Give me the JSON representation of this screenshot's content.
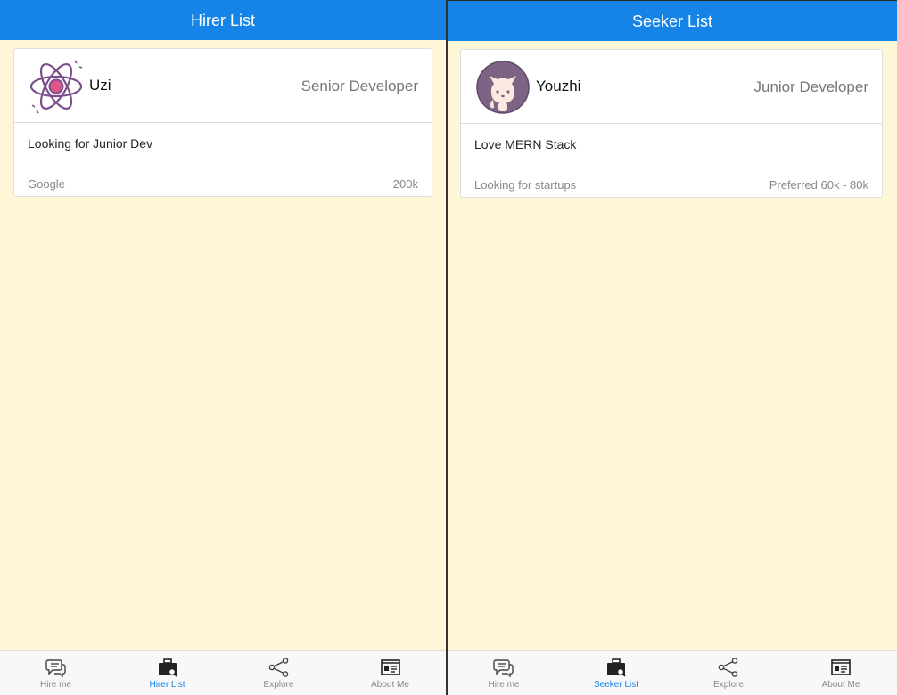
{
  "left": {
    "header": {
      "title": "Hirer List"
    },
    "card": {
      "avatar_icon": "react-atom-icon",
      "name": "Uzi",
      "role": "Senior Developer",
      "description": "Looking for Junior Dev",
      "company": "Google",
      "salary": "200k"
    },
    "tabs": [
      {
        "label": "Hire me",
        "icon": "chat-icon",
        "active": false
      },
      {
        "label": "Hirer List",
        "icon": "briefcase-icon",
        "active": true
      },
      {
        "label": "Explore",
        "icon": "share-icon",
        "active": false
      },
      {
        "label": "About Me",
        "icon": "id-card-icon",
        "active": false
      }
    ]
  },
  "right": {
    "header": {
      "title": "Seeker List"
    },
    "card": {
      "avatar_icon": "octocat-icon",
      "name": "Youzhi",
      "role": "Junior Developer",
      "description": "Love MERN Stack",
      "note": "Looking for startups",
      "salary": "Preferred 60k - 80k"
    },
    "tabs": [
      {
        "label": "Hire me",
        "icon": "chat-icon",
        "active": false
      },
      {
        "label": "Seeker List",
        "icon": "briefcase-icon",
        "active": true
      },
      {
        "label": "Explore",
        "icon": "share-icon",
        "active": false
      },
      {
        "label": "About Me",
        "icon": "id-card-icon",
        "active": false
      }
    ]
  },
  "colors": {
    "header_blue": "#1584e6",
    "background": "#fff5d7",
    "active_tab": "#1584e6",
    "inactive_tab": "#888888"
  }
}
